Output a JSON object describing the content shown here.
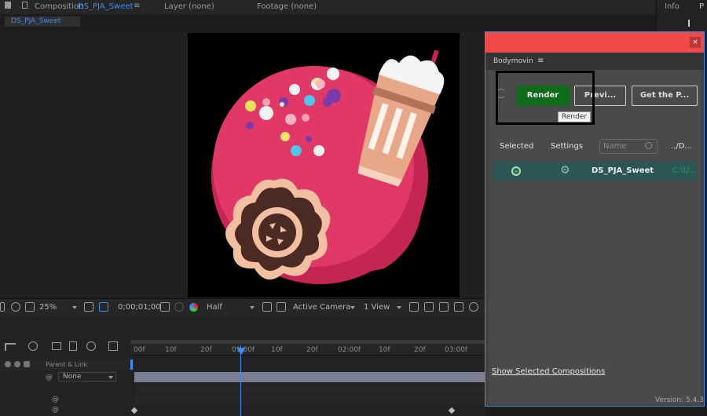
{
  "topbar": {
    "composition_label": "Composition",
    "composition_name": "DS_PJA_Sweet",
    "menu_glyph": "≡",
    "layer_label": "Layer (none)",
    "footage_label": "Footage (none)",
    "info_label": "Info",
    "info_p": "P"
  },
  "comp_tab": {
    "label": "DS_PJA_Sweet"
  },
  "viewer_toolbar": {
    "zoom": "25%",
    "timecode": "0;00;01;00",
    "resolution": "Half",
    "camera": "Active Camera",
    "views": "1 View"
  },
  "timeline": {
    "ticks": [
      "00f",
      "10f",
      "20f",
      "01:00f",
      "10f",
      "20f",
      "02:00f",
      "10f",
      "20f",
      "03:00f"
    ],
    "parent_link_header": "Parent & Link",
    "parent_value": "None"
  },
  "bodymovin": {
    "close_glyph": "×",
    "title": "Bodymovin",
    "menu_glyph": "≡",
    "render_button": "Render",
    "preview_button": "Previ...",
    "get_player_button": "Get the P...",
    "tooltip": "Render",
    "col_selected": "Selected",
    "col_settings": "Settings",
    "search_placeholder": "Name",
    "col_destination": "../D...",
    "rows": [
      {
        "name": "DS_PJA_Sweet",
        "path": "C:\\U..."
      }
    ],
    "show_selected_link": "Show Selected Compositions",
    "version": "Version: 5.4.3"
  },
  "colors": {
    "accent_blue": "#3d8df5",
    "bodymovin_red": "#f24848",
    "render_green": "#0e6b1a",
    "row_teal": "#2b5654"
  }
}
